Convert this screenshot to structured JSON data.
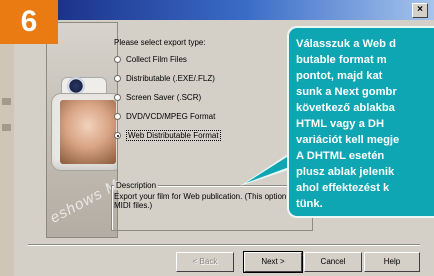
{
  "step_number": "6",
  "dialog": {
    "close_label": "×",
    "prompt": "Please select export type:",
    "options": [
      {
        "label": "Collect Film Files",
        "selected": false
      },
      {
        "label": "Distributable (.EXE/.FLZ)",
        "selected": false
      },
      {
        "label": "Screen Saver (.SCR)",
        "selected": false
      },
      {
        "label": "DVD/VCD/MPEG Format",
        "selected": false
      },
      {
        "label": "Web Distributable Format",
        "selected": true
      }
    ],
    "description_title": "Description",
    "description_text": "Export your film for Web publication. (This option d MIDI files.)",
    "image_watermark": "eshows M",
    "buttons": {
      "back": "< Back",
      "next": "Next >",
      "cancel": "Cancel",
      "help": "Help"
    }
  },
  "callout": {
    "lines": [
      "Válasszuk a Web d",
      "butable format m",
      "pontot, majd kat",
      "sunk a Next gombr",
      "következő ablakba",
      "HTML vagy a DH",
      "variációt kell megje",
      "A DHTML esetén",
      "plusz ablak jelenik",
      "ahol effektezést k",
      "tünk."
    ],
    "background_color": "#0ea6b2"
  },
  "colors": {
    "badge": "#ea7a12",
    "titlebar": "#15257c"
  }
}
